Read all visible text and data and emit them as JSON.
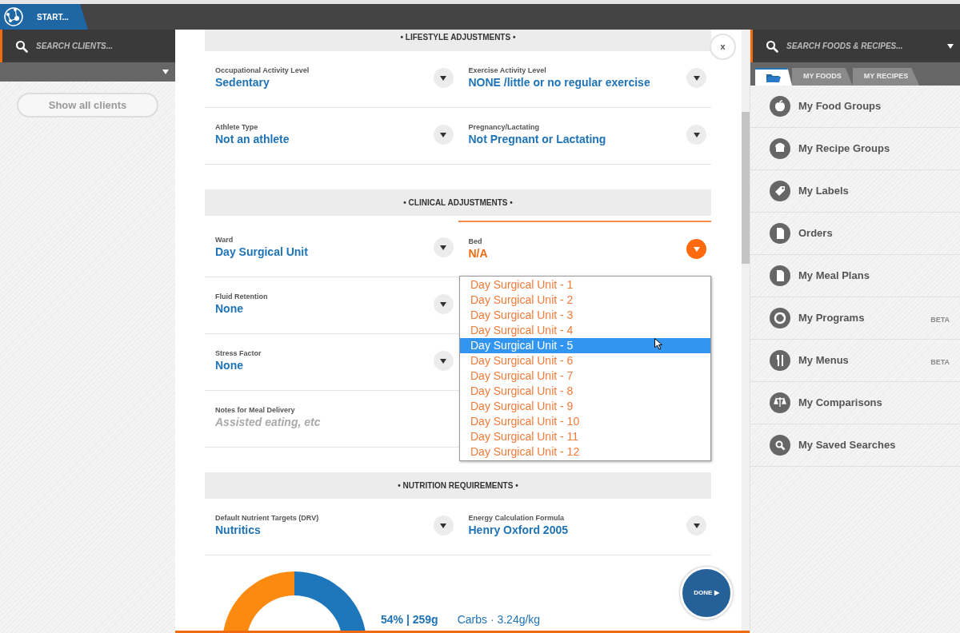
{
  "top_bar": {
    "start_label": "START..."
  },
  "clients_panel": {
    "search": {
      "placeholder": "SEARCH CLIENTS..."
    },
    "show_all_button": "Show all clients"
  },
  "modal": {
    "close_label": "x",
    "sections": [
      {
        "title": "•  LIFESTYLE ADJUSTMENTS  •",
        "rows": [
          [
            {
              "kind": "select",
              "label": "Occupational Activity Level",
              "value": "Sedentary",
              "active": false
            },
            {
              "kind": "select",
              "label": "Exercise Activity Level",
              "value": "NONE /little or no regular exercise",
              "active": false
            }
          ],
          [
            {
              "kind": "select",
              "label": "Athlete Type",
              "value": "Not an athlete",
              "active": false
            },
            {
              "kind": "select",
              "label": "Pregnancy/Lactating",
              "value": "Not Pregnant or Lactating",
              "active": false
            }
          ]
        ]
      },
      {
        "title": "•  CLINICAL ADJUSTMENTS  •",
        "rows": [
          [
            {
              "kind": "select",
              "label": "Ward",
              "value": "Day Surgical Unit",
              "active": false
            },
            {
              "kind": "select",
              "label": "Bed",
              "value": "N/A",
              "active": true
            }
          ],
          [
            {
              "kind": "select",
              "label": "Fluid Retention",
              "value": "None",
              "active": false
            }
          ],
          [
            {
              "kind": "select",
              "label": "Stress Factor",
              "value": "None",
              "active": false
            }
          ],
          [
            {
              "kind": "text",
              "label": "Notes for Meal Delivery",
              "placeholder": "Assisted eating, etc"
            }
          ]
        ]
      },
      {
        "title": "•  NUTRITION REQUIREMENTS  •",
        "rows": [
          [
            {
              "kind": "select",
              "label": "Default Nutrient Targets (DRV)",
              "value": "Nutritics",
              "active": false
            },
            {
              "kind": "select",
              "label": "Energy Calculation Formula",
              "value": "Henry Oxford 2005",
              "active": false
            }
          ]
        ]
      }
    ],
    "summary": {
      "share": "54% | 259g",
      "description": "Carbs · 3.24g/kg"
    },
    "done_button": "DONE ▶"
  },
  "dropdown": {
    "options": [
      {
        "label": "Day Surgical Unit - 1",
        "selected": false
      },
      {
        "label": "Day Surgical Unit - 2",
        "selected": false
      },
      {
        "label": "Day Surgical Unit - 3",
        "selected": false
      },
      {
        "label": "Day Surgical Unit - 4",
        "selected": false
      },
      {
        "label": "Day Surgical Unit - 5",
        "selected": true
      },
      {
        "label": "Day Surgical Unit - 6",
        "selected": false
      },
      {
        "label": "Day Surgical Unit - 7",
        "selected": false
      },
      {
        "label": "Day Surgical Unit - 8",
        "selected": false
      },
      {
        "label": "Day Surgical Unit - 9",
        "selected": false
      },
      {
        "label": "Day Surgical Unit - 10",
        "selected": false
      },
      {
        "label": "Day Surgical Unit - 11",
        "selected": false
      },
      {
        "label": "Day Surgical Unit - 12",
        "selected": false
      }
    ]
  },
  "library_panel": {
    "search": {
      "placeholder": "SEARCH FOODS & RECIPES..."
    },
    "tabs": [
      {
        "kind": "icon",
        "selected": true
      },
      {
        "kind": "text",
        "label": "MY FOODS",
        "selected": false
      },
      {
        "kind": "text",
        "label": "MY RECIPES",
        "selected": false
      }
    ],
    "items": [
      {
        "label": "My Food Groups"
      },
      {
        "label": "My Recipe Groups"
      },
      {
        "label": "My Labels"
      },
      {
        "label": "Orders"
      },
      {
        "label": "My Meal Plans"
      },
      {
        "label": "My Programs",
        "badge": "BETA"
      },
      {
        "label": "My Menus",
        "badge": "BETA"
      },
      {
        "label": "My Comparisons"
      },
      {
        "label": "My Saved Searches"
      }
    ]
  }
}
